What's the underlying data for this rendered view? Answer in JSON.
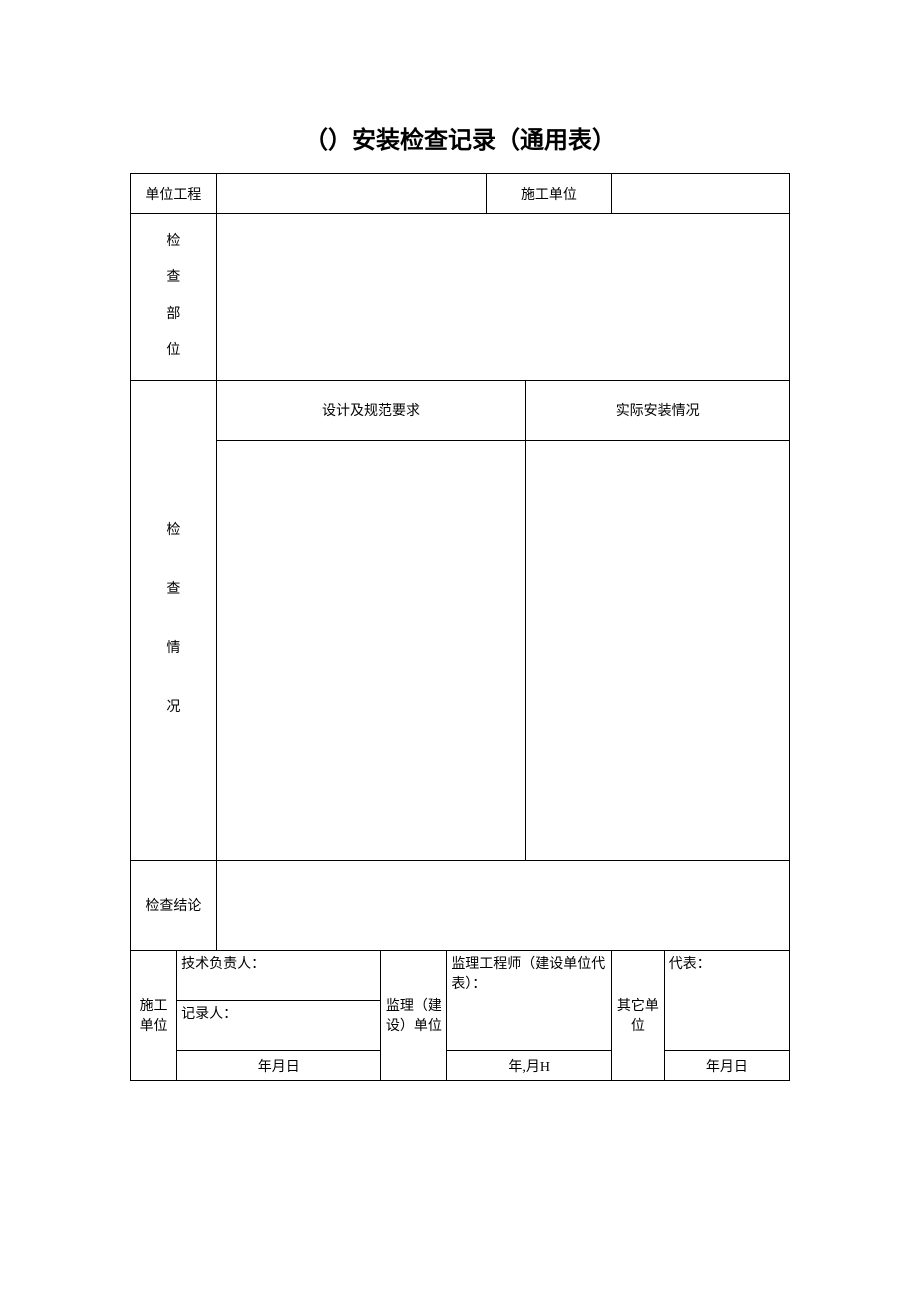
{
  "title": "（）安装检查记录（通用表）",
  "row1": {
    "label_unit_project": "单位工程",
    "value_unit_project": "",
    "label_construction_unit": "施工单位",
    "value_construction_unit": ""
  },
  "inspect_position_label_chars": [
    "检",
    "查",
    "部",
    "位"
  ],
  "inspect_position_value": "",
  "headers": {
    "design_req": "设计及规范要求",
    "actual_install": "实际安装情况"
  },
  "inspect_situation_label_chars": [
    "检",
    "查",
    "情",
    "况"
  ],
  "design_req_value": "",
  "actual_install_value": "",
  "conclusion_label": "检查结论",
  "conclusion_value": "",
  "signoff": {
    "construction_unit_label": "施工单位",
    "tech_leader": "技术负责人：",
    "recorder": "记录人：",
    "date1": "年月日",
    "supervision_unit_label": "监理（建设）单位",
    "supervision_engineer": "监理工程师（建设单位代表）：",
    "date2": "年,月H",
    "other_unit_label": "其它单位",
    "representative": "代表：",
    "date3": "年月日"
  }
}
